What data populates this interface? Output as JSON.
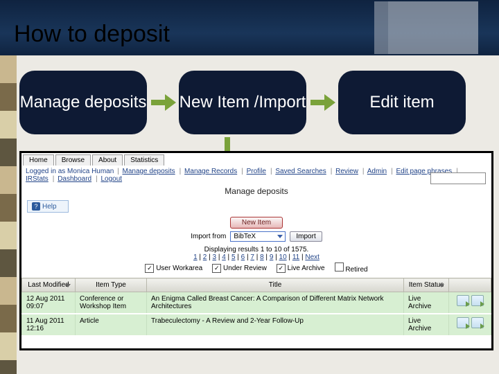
{
  "title": "How to deposit",
  "steps": [
    "Manage deposits",
    "New Item /Import",
    "Edit item"
  ],
  "tabs": [
    "Home",
    "Browse",
    "About",
    "Statistics"
  ],
  "nav1": {
    "prefix": "Logged in as Monica Human",
    "items": [
      "Manage deposits",
      "Manage Records",
      "Profile",
      "Saved Searches",
      "Review",
      "Admin",
      "Edit page phrases",
      "IRStats",
      "Dashboard",
      "Logout"
    ]
  },
  "page_heading": "Manage deposits",
  "help_label": "Help",
  "new_item_label": "New Item",
  "import": {
    "label": "Import from",
    "selected": "BibTeX",
    "button": "Import"
  },
  "pager": {
    "summary": "Displaying results 1 to 10 of 1575.",
    "pages": [
      "1",
      "2",
      "3",
      "4",
      "5",
      "6",
      "7",
      "8",
      "9",
      "10",
      "11"
    ],
    "next": "Next"
  },
  "filters": [
    {
      "label": "User Workarea",
      "checked": true
    },
    {
      "label": "Under Review",
      "checked": true
    },
    {
      "label": "Live Archive",
      "checked": true
    },
    {
      "label": "Retired",
      "checked": false
    }
  ],
  "columns": [
    "Last Modified",
    "Item Type",
    "Title",
    "Item Status"
  ],
  "rows": [
    {
      "modified": "12 Aug 2011 09:07",
      "type": "Conference or Workshop Item",
      "title": "An Enigma Called Breast Cancer: A Comparison of Different Matrix Network Architectures",
      "status": "Live Archive"
    },
    {
      "modified": "11 Aug 2011 12:16",
      "type": "Article",
      "title": "Trabeculectomy - A Review and 2-Year Follow-Up",
      "status": "Live Archive"
    }
  ]
}
